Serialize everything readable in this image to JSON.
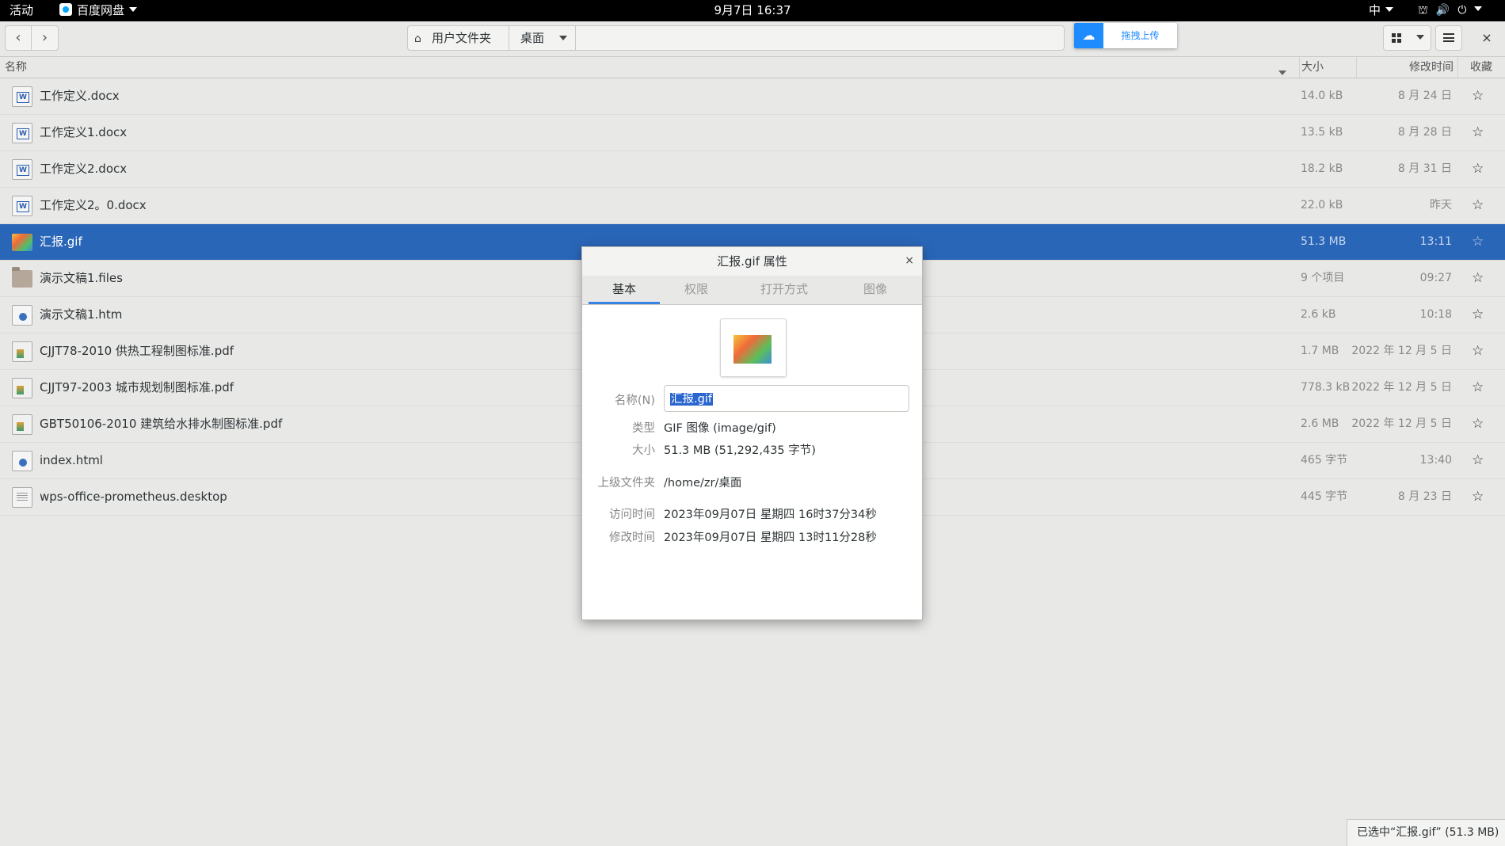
{
  "topbar": {
    "activities": "活动",
    "app_name": "百度网盘",
    "clock": "9月7日 16:37",
    "ime": "中",
    "icons": [
      "network-icon",
      "volume-icon",
      "power-icon"
    ]
  },
  "header": {
    "back": "‹",
    "forward": "›",
    "breadcrumb_home": "用户文件夹",
    "breadcrumb_current": "桌面",
    "upload_label": "拖拽上传",
    "close": "×"
  },
  "columns": {
    "name": "名称",
    "size": "大小",
    "modified": "修改时间",
    "starred": "收藏"
  },
  "files": [
    {
      "name": "工作定义.docx",
      "size": "14.0 kB",
      "modified": "8 月 24 日",
      "icon": "doc"
    },
    {
      "name": "工作定义1.docx",
      "size": "13.5 kB",
      "modified": "8 月 28 日",
      "icon": "doc"
    },
    {
      "name": "工作定义2.docx",
      "size": "18.2 kB",
      "modified": "8 月 31 日",
      "icon": "doc"
    },
    {
      "name": "工作定义2。0.docx",
      "size": "22.0 kB",
      "modified": "昨天",
      "icon": "doc"
    },
    {
      "name": "汇报.gif",
      "size": "51.3 MB",
      "modified": "13:11",
      "icon": "gif",
      "selected": true
    },
    {
      "name": "演示文稿1.files",
      "size": "9 个项目",
      "modified": "09:27",
      "icon": "folder"
    },
    {
      "name": "演示文稿1.htm",
      "size": "2.6 kB",
      "modified": "10:18",
      "icon": "web"
    },
    {
      "name": "CJJT78-2010 供热工程制图标准.pdf",
      "size": "1.7 MB",
      "modified": "2022 年 12 月 5 日",
      "icon": "pdf"
    },
    {
      "name": "CJJT97-2003 城市规划制图标准.pdf",
      "size": "778.3 kB",
      "modified": "2022 年 12 月 5 日",
      "icon": "pdf"
    },
    {
      "name": "GBT50106-2010 建筑给水排水制图标准.pdf",
      "size": "2.6 MB",
      "modified": "2022 年 12 月 5 日",
      "icon": "pdf"
    },
    {
      "name": "index.html",
      "size": "465 字节",
      "modified": "13:40",
      "icon": "web"
    },
    {
      "name": "wps-office-prometheus.desktop",
      "size": "445 字节",
      "modified": "8 月 23 日",
      "icon": "text"
    }
  ],
  "status": "已选中“汇报.gif” (51.3 MB)",
  "dialog": {
    "title": "汇报.gif 属性",
    "close": "×",
    "tabs": [
      "基本",
      "权限",
      "打开方式",
      "图像"
    ],
    "active_tab": "基本",
    "name_label": "名称(N)",
    "name_value": "汇报.gif",
    "type_label": "类型",
    "type_value": "GIF 图像 (image/gif)",
    "size_label": "大小",
    "size_value": "51.3 MB (51,292,435 字节)",
    "parent_label": "上级文件夹",
    "parent_value": "/home/zr/桌面",
    "accessed_label": "访问时间",
    "accessed_value": "2023年09月07日 星期四 16时37分34秒",
    "modified_label": "修改时间",
    "modified_value": "2023年09月07日 星期四 13时11分28秒"
  }
}
